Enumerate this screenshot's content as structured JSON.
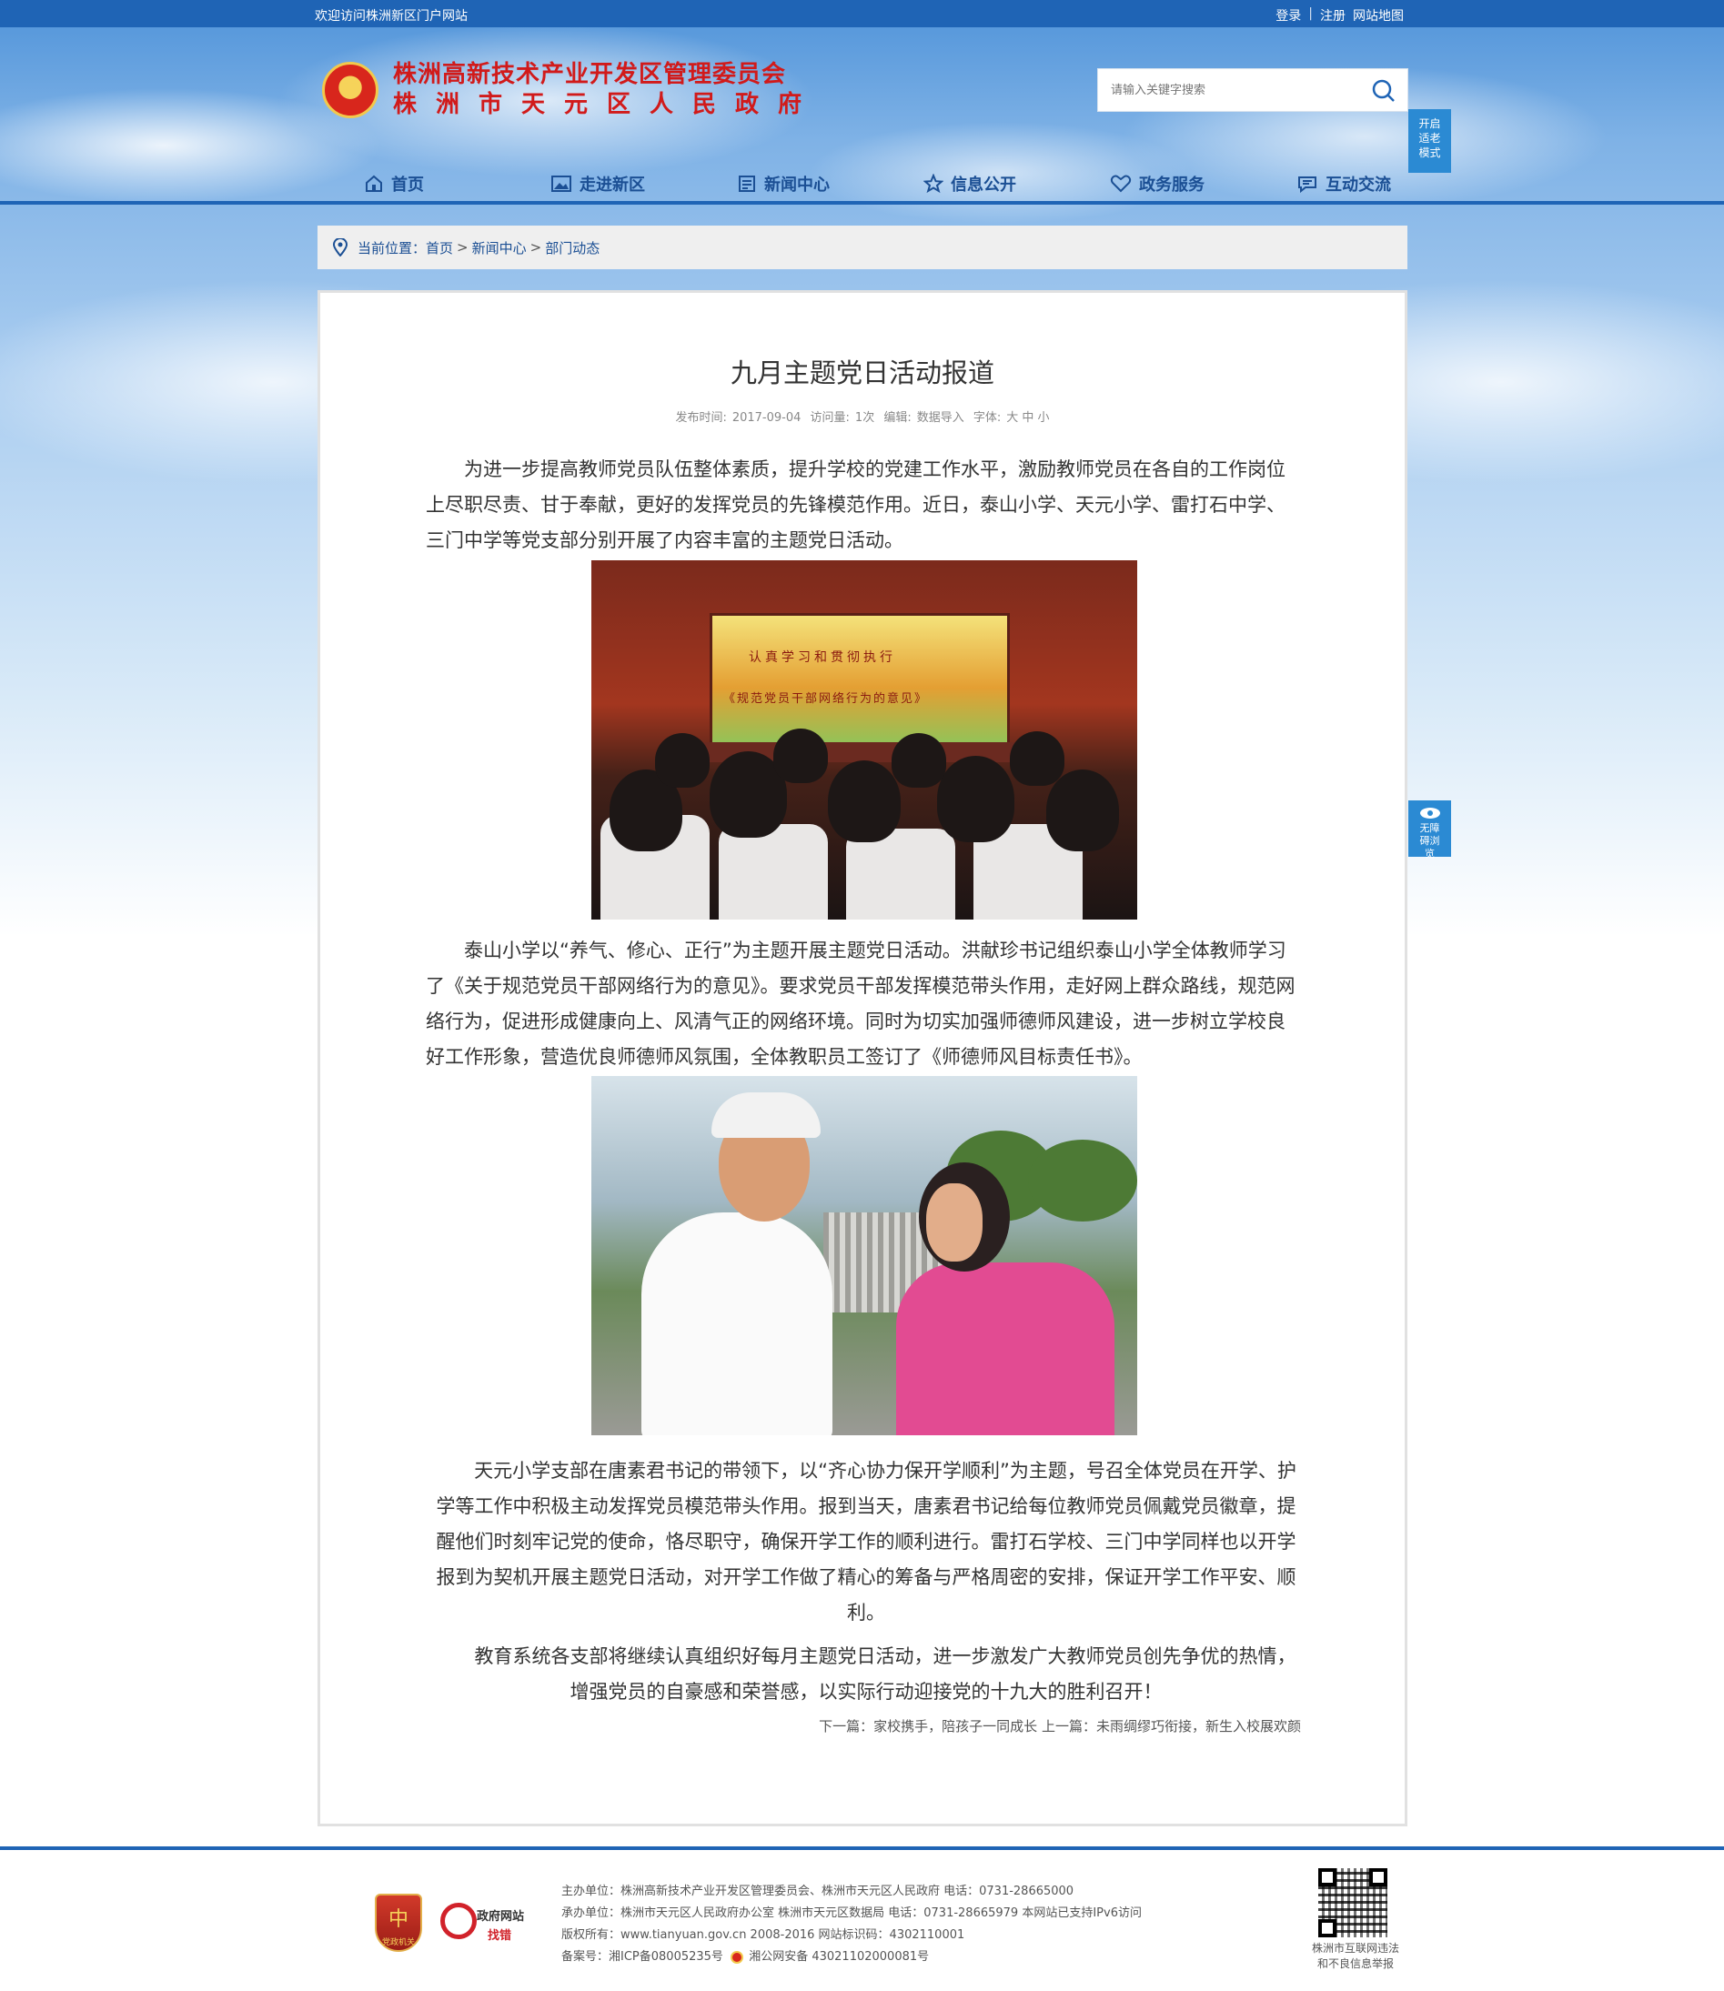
{
  "topbar": {
    "welcome": "欢迎访问株洲新区门户网站",
    "login": "登录",
    "sep": "|",
    "register": "注册",
    "sitemap": "网站地图"
  },
  "header": {
    "title_line1": "株洲高新技术产业开发区管理委员会",
    "title_line2": "株洲市天元区人民政府",
    "search_placeholder": "请输入关键字搜索",
    "elder_mode_label": "开启适老模式"
  },
  "nav": {
    "items": [
      {
        "label": "首页",
        "icon": "home-icon"
      },
      {
        "label": "走进新区",
        "icon": "image-icon"
      },
      {
        "label": "新闻中心",
        "icon": "news-icon"
      },
      {
        "label": "信息公开",
        "icon": "star-icon"
      },
      {
        "label": "政务服务",
        "icon": "heart-icon"
      },
      {
        "label": "互动交流",
        "icon": "chat-icon"
      }
    ]
  },
  "breadcrumb": {
    "prefix": "当前位置：",
    "items": [
      "首页",
      "新闻中心",
      "部门动态"
    ],
    "separator": ">"
  },
  "article": {
    "title": "九月主题党日活动报道",
    "meta": {
      "publish_label": "发布时间:",
      "publish_date": "2017-09-04",
      "visits_label": "访问量:",
      "visits": "1次",
      "editor_label": "编辑:",
      "editor": "数据导入",
      "font_label": "字体:",
      "font_sizes": "大 中 小"
    },
    "paragraphs": [
      "为进一步提高教师党员队伍整体素质，提升学校的党建工作水平，激励教师党员在各自的工作岗位上尽职尽责、甘于奉献，更好的发挥党员的先锋模范作用。近日，泰山小学、天元小学、雷打石中学、三门中学等党支部分别开展了内容丰富的主题党日活动。",
      "泰山小学以“养气、修心、正行”为主题开展主题党日活动。洪献珍书记组织泰山小学全体教师学习了《关于规范党员干部网络行为的意见》。要求党员干部发挥模范带头作用，走好网上群众路线，规范网络行为，促进形成健康向上、风清气正的网络环境。同时为切实加强师德师风建设，进一步树立学校良好工作形象，营造优良师德师风氛围，全体教职员工签订了《师德师风目标责任书》。",
      "天元小学支部在唐素君书记的带领下，以“齐心协力保开学顺利”为主题，号召全体党员在开学、护学等工作中积极主动发挥党员模范带头作用。报到当天，唐素君书记给每位教师党员佩戴党员徽章，提醒他们时刻牢记党的使命，恪尽职守，确保开学工作的顺利进行。雷打石学校、三门中学同样也以开学报到为契机开展主题党日活动，对开学工作做了精心的筹备与严格周密的安排，保证开学工作平安、顺利。",
      "教育系统各支部将继续认真组织好每月主题党日活动，进一步激发广大教师党员创先争优的热情，增强党员的自豪感和荣誉感，以实际行动迎接党的十九大的胜利召开！"
    ],
    "photo1_text_line1": "认真学习和贯彻执行",
    "photo1_text_line2": "《规范党员干部网络行为的意见》",
    "next_label": "下一篇：",
    "next_title": "家校携手，陪孩子一同成长",
    "prev_label": "上一篇：",
    "prev_title": "未雨绸缪巧衔接，新生入校展欢颜"
  },
  "side": {
    "accessibility_label": "无障碍浏览"
  },
  "footer": {
    "badge1_text": "党政机关",
    "badge2_line1": "政府网站",
    "badge2_line2": "找错",
    "host": "主办单位：株洲高新技术产业开发区管理委员会、株洲市天元区人民政府 电话：0731-28665000",
    "undertaker": "承办单位：株洲市天元区人民政府办公室 株洲市天元区数据局 电话：0731-28665979 本网站已支持IPv6访问",
    "copyright": "版权所有：www.tianyuan.gov.cn 2008-2016 网站标识码：4302110001",
    "icp": "备案号：湘ICP备08005235号",
    "police": "湘公网安备 43021102000081号",
    "qr_caption_line1": "株洲市互联网违法",
    "qr_caption_line2": "和不良信息举报"
  }
}
